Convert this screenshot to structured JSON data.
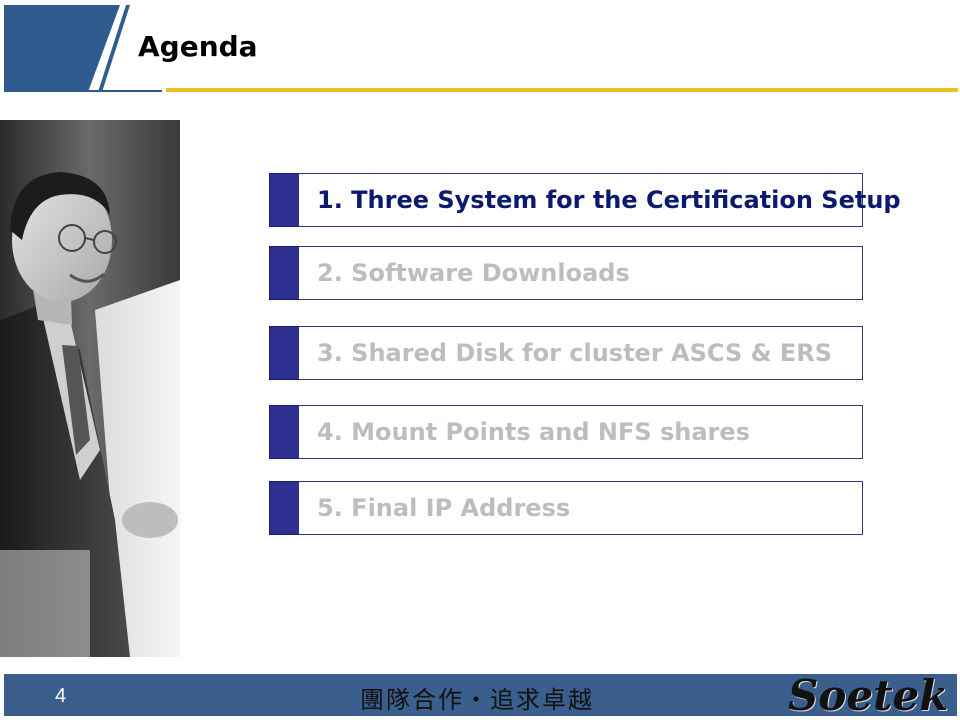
{
  "slide": {
    "title": "Agenda",
    "page_number": "4"
  },
  "agenda": {
    "items": [
      {
        "label": "1. Three System for the Certification Setup",
        "state": "active"
      },
      {
        "label": "2. Software Downloads",
        "state": "inactive"
      },
      {
        "label": "3. Shared Disk for cluster ASCS & ERS",
        "state": "inactive"
      },
      {
        "label": "4. Mount Points and NFS shares",
        "state": "inactive"
      },
      {
        "label": "5. Final IP Address",
        "state": "inactive"
      }
    ]
  },
  "footer": {
    "slogan": "團隊合作・追求卓越",
    "logo_text": "Soetek"
  },
  "colors": {
    "header_blue": "#2f5b8f",
    "gold_line": "#f0c020",
    "marker_navy": "#2e3192",
    "active_text": "#0b1a6e",
    "inactive_text": "#bdbdbd",
    "footer_blue": "#3a5f8c"
  },
  "icons": {
    "photo": "businessman-photo"
  }
}
